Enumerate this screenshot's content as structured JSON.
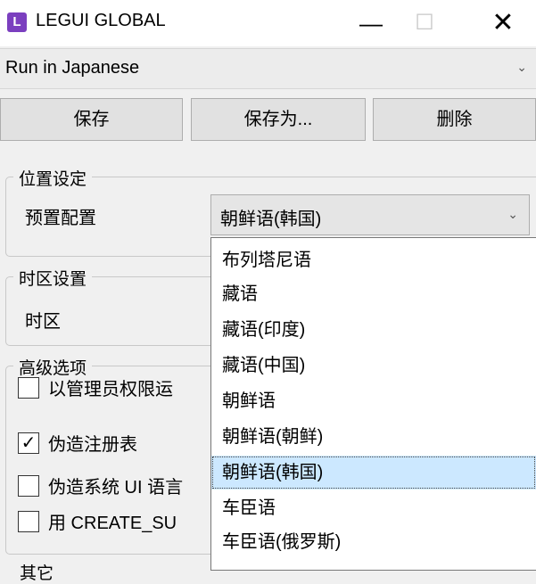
{
  "window": {
    "icon_letter": "L",
    "title": "LEGUI GLOBAL",
    "minimize_symbol": "—",
    "maximize_symbol": "☐",
    "close_symbol": "✕"
  },
  "profile": {
    "selected": "Run in Japanese",
    "chevron": "⌄"
  },
  "buttons": {
    "save": "保存",
    "save_as": "保存为...",
    "delete": "删除"
  },
  "location": {
    "group_title": "位置设定",
    "preset_label": "预置配置",
    "preset_value": "朝鲜语(韩国)",
    "chevron": "⌄"
  },
  "timezone": {
    "group_title": "时区设置",
    "label": "时区"
  },
  "advanced": {
    "group_title": "高级选项",
    "options": [
      {
        "label": "以管理员权限运",
        "checked": false
      },
      {
        "label": "伪造注册表",
        "checked": true
      },
      {
        "label": "伪造系统 UI 语言",
        "checked": false
      },
      {
        "label": "用 CREATE_SU",
        "checked": false
      }
    ]
  },
  "other": {
    "group_title": "其它"
  },
  "dropdown": {
    "items": [
      "布列塔尼语",
      "藏语",
      "藏语(印度)",
      "藏语(中国)",
      "朝鲜语",
      "朝鲜语(朝鲜)",
      "朝鲜语(韩国)",
      "车臣语",
      "车臣语(俄罗斯)"
    ],
    "selected_index": 6
  }
}
